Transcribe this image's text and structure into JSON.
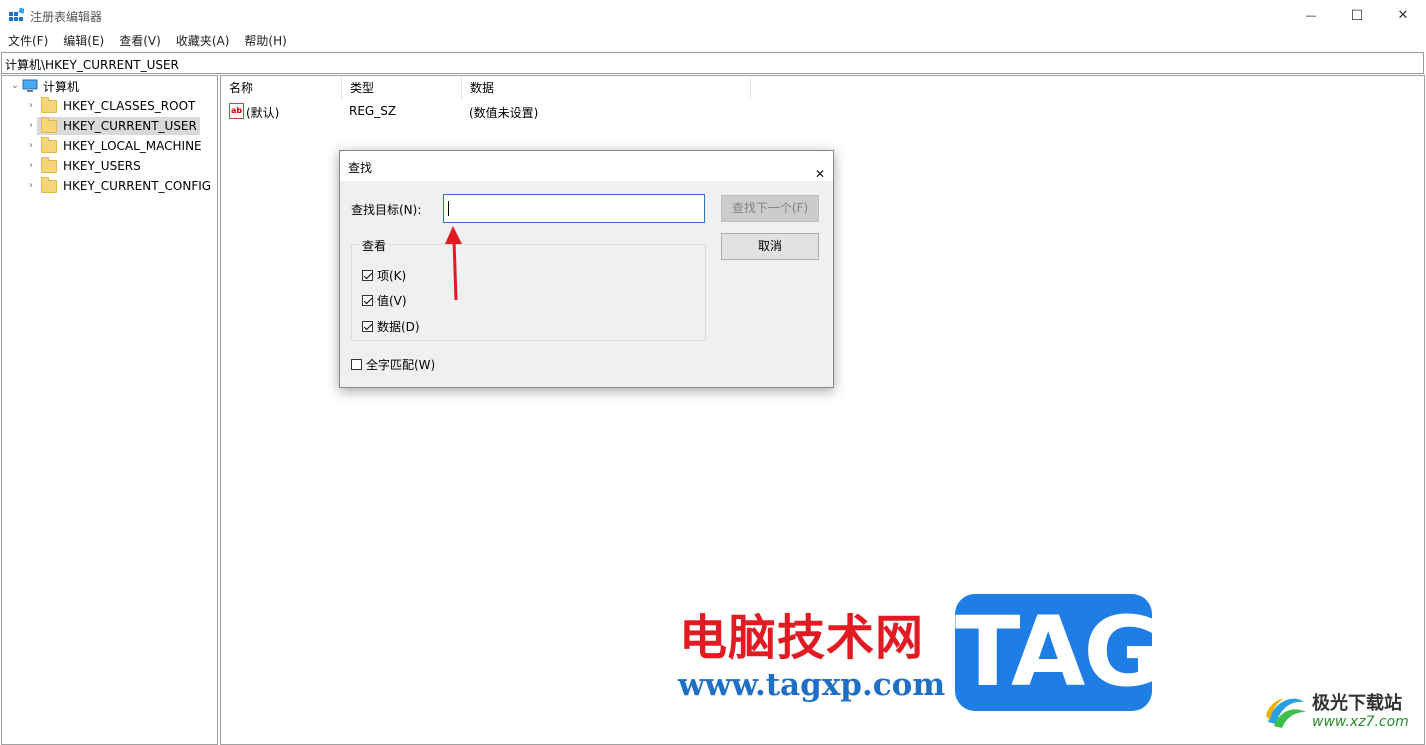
{
  "window": {
    "title": "注册表编辑器",
    "controls": {
      "minimize": "—",
      "maximize": "☐",
      "close": "✕"
    }
  },
  "menu": [
    "文件(F)",
    "编辑(E)",
    "查看(V)",
    "收藏夹(A)",
    "帮助(H)"
  ],
  "address": "计算机\\HKEY_CURRENT_USER",
  "tree": {
    "root": "计算机",
    "items": [
      "HKEY_CLASSES_ROOT",
      "HKEY_CURRENT_USER",
      "HKEY_LOCAL_MACHINE",
      "HKEY_USERS",
      "HKEY_CURRENT_CONFIG"
    ],
    "selected": "HKEY_CURRENT_USER"
  },
  "list": {
    "columns": [
      "名称",
      "类型",
      "数据"
    ],
    "rows": [
      {
        "name": "(默认)",
        "type": "REG_SZ",
        "data": "(数值未设置)",
        "icon": "ab"
      }
    ]
  },
  "dialog": {
    "title": "查找",
    "close": "✕",
    "find_label": "查找目标(N):",
    "find_value": "",
    "find_next": "查找下一个(F)",
    "cancel": "取消",
    "look_at": "查看",
    "options": [
      {
        "label": "项(K)",
        "checked": true
      },
      {
        "label": "值(V)",
        "checked": true
      },
      {
        "label": "数据(D)",
        "checked": true
      }
    ],
    "match_whole": {
      "label": "全字匹配(W)",
      "checked": false
    }
  },
  "watermark": {
    "cn": "电脑技术网",
    "url": "www.tagxp.com",
    "tag": "TAG",
    "site2_cn": "极光下载站",
    "site2_url": "www.xz7.com"
  },
  "colors": {
    "accent": "#2a73c7",
    "arrow": "#e21b23",
    "tag_bg": "#1e7ee6"
  }
}
